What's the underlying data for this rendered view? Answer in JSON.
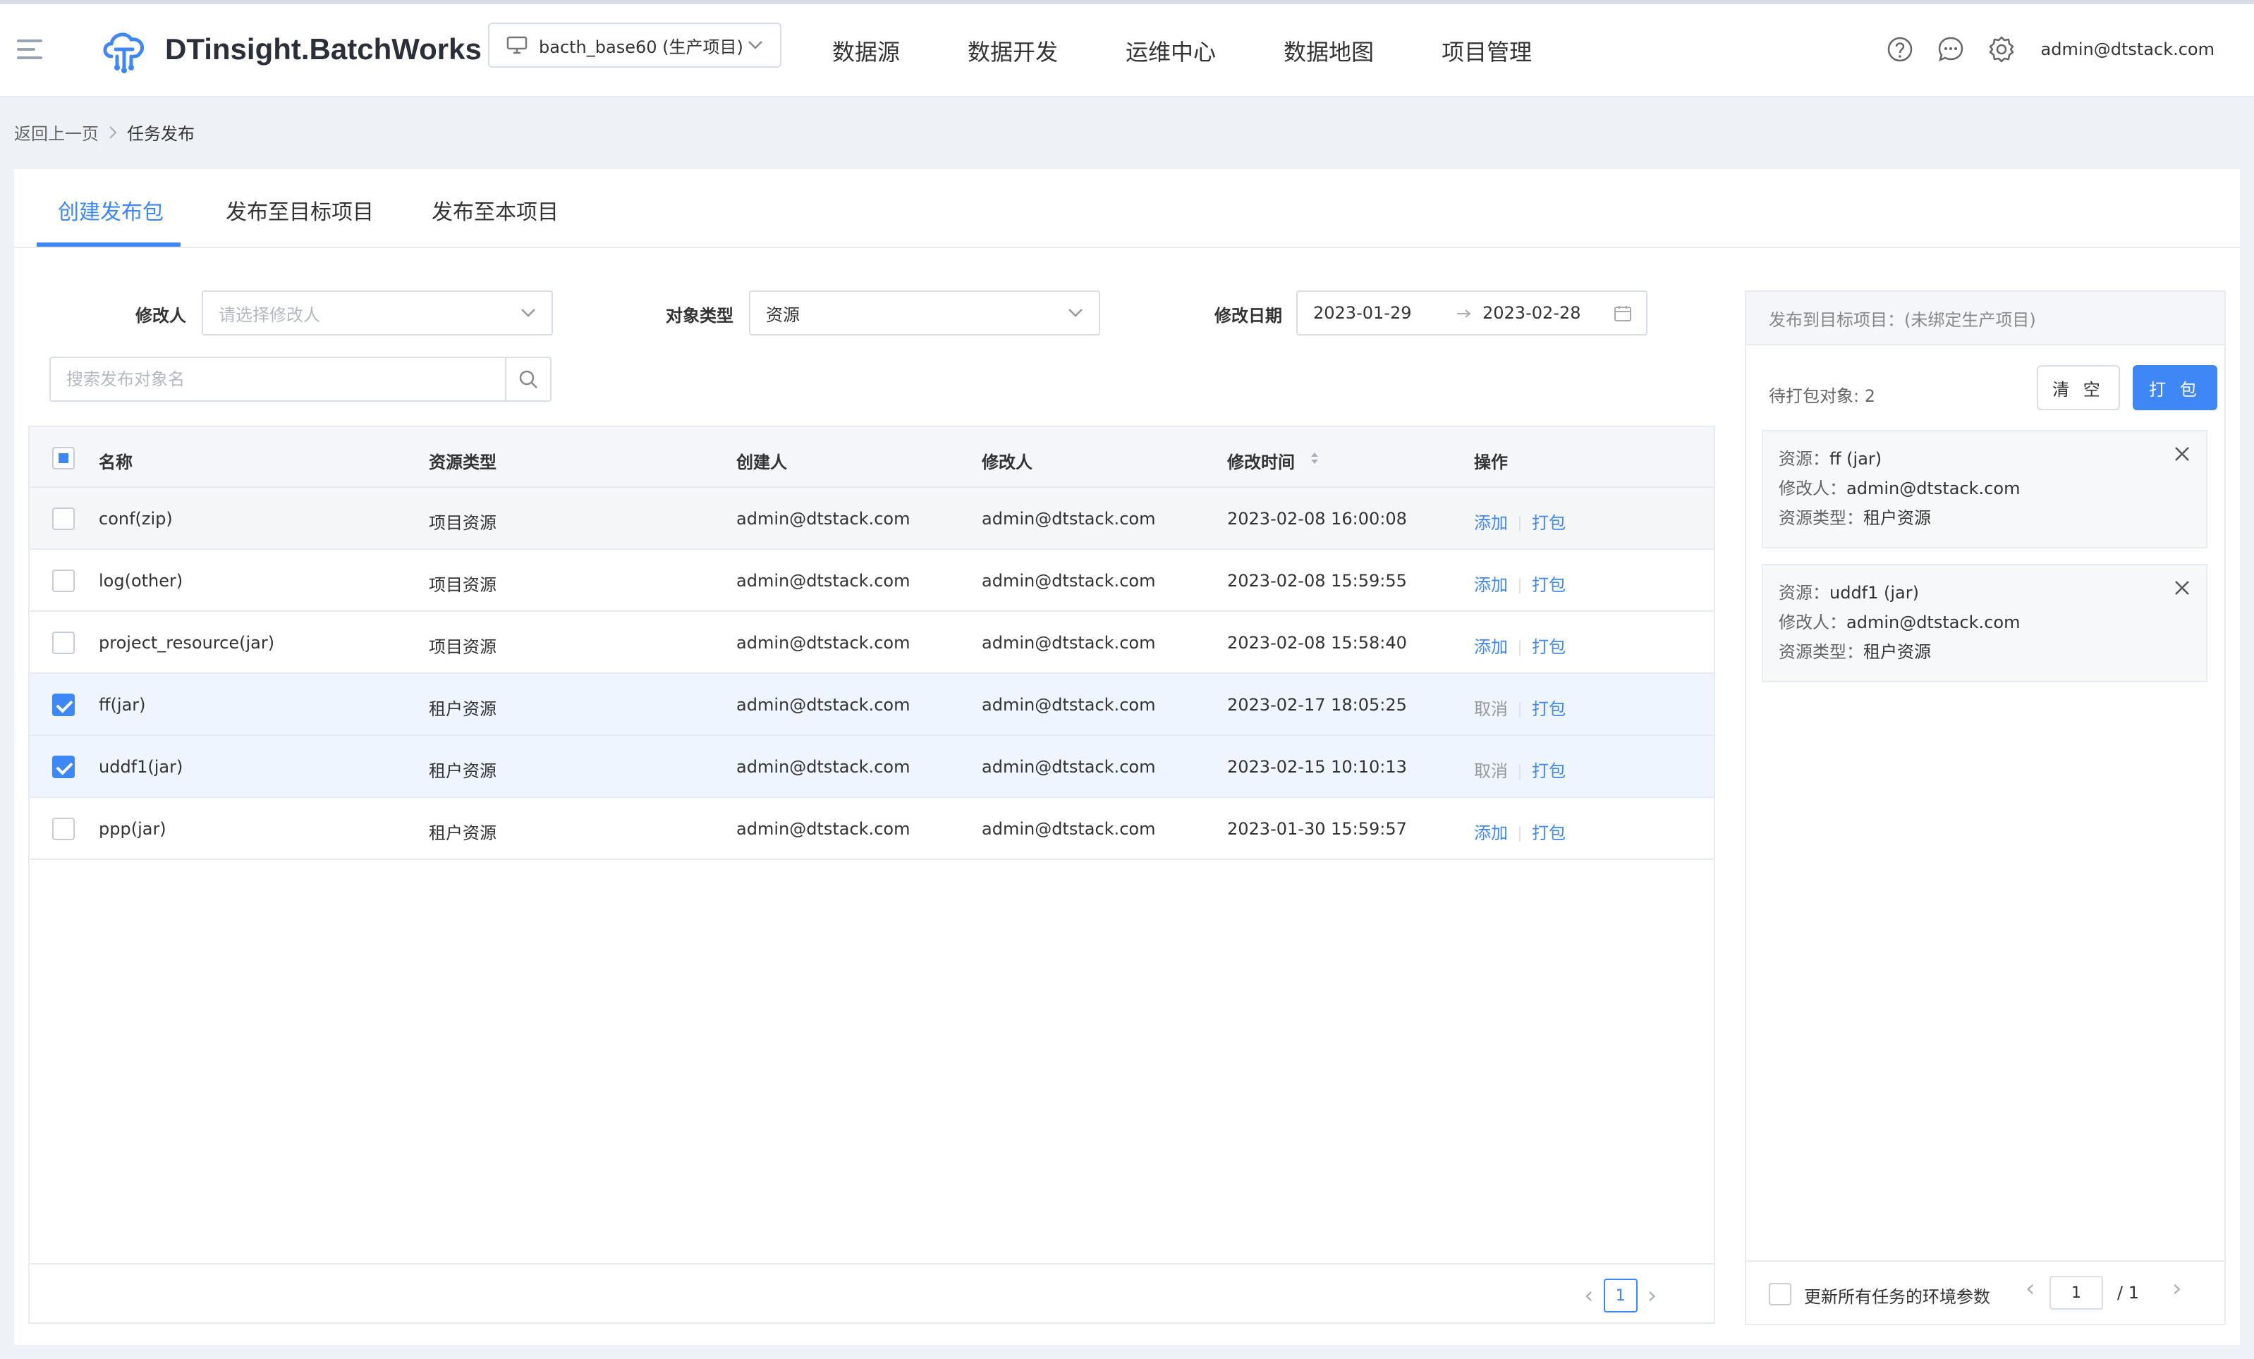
{
  "header": {
    "app_title": "DTinsight.BatchWorks",
    "project": "bacth_base60 (生产项目)",
    "nav": [
      "数据源",
      "数据开发",
      "运维中心",
      "数据地图",
      "项目管理"
    ],
    "user": "admin@dtstack.com"
  },
  "breadcrumb": {
    "back": "返回上一页",
    "current": "任务发布"
  },
  "tabs": [
    "创建发布包",
    "发布至目标项目",
    "发布至本项目"
  ],
  "filters": {
    "modifier_label": "修改人",
    "modifier_placeholder": "请选择修改人",
    "type_label": "对象类型",
    "type_value": "资源",
    "date_label": "修改日期",
    "date_start": "2023-01-29",
    "date_end": "2023-02-28",
    "search_placeholder": "搜索发布对象名"
  },
  "table": {
    "columns": [
      "名称",
      "资源类型",
      "创建人",
      "修改人",
      "修改时间",
      "操作"
    ],
    "rows": [
      {
        "name": "conf(zip)",
        "type": "项目资源",
        "creator": "admin@dtstack.com",
        "modifier": "admin@dtstack.com",
        "time": "2023-02-08 16:00:08",
        "action": "添加",
        "pack": "打包",
        "checked": false
      },
      {
        "name": "log(other)",
        "type": "项目资源",
        "creator": "admin@dtstack.com",
        "modifier": "admin@dtstack.com",
        "time": "2023-02-08 15:59:55",
        "action": "添加",
        "pack": "打包",
        "checked": false
      },
      {
        "name": "project_resource(jar)",
        "type": "项目资源",
        "creator": "admin@dtstack.com",
        "modifier": "admin@dtstack.com",
        "time": "2023-02-08 15:58:40",
        "action": "添加",
        "pack": "打包",
        "checked": false
      },
      {
        "name": "ff(jar)",
        "type": "租户资源",
        "creator": "admin@dtstack.com",
        "modifier": "admin@dtstack.com",
        "time": "2023-02-17 18:05:25",
        "action": "取消",
        "pack": "打包",
        "checked": true
      },
      {
        "name": "uddf1(jar)",
        "type": "租户资源",
        "creator": "admin@dtstack.com",
        "modifier": "admin@dtstack.com",
        "time": "2023-02-15 10:10:13",
        "action": "取消",
        "pack": "打包",
        "checked": true
      },
      {
        "name": "ppp(jar)",
        "type": "租户资源",
        "creator": "admin@dtstack.com",
        "modifier": "admin@dtstack.com",
        "time": "2023-01-30 15:59:57",
        "action": "添加",
        "pack": "打包",
        "checked": false
      }
    ],
    "page": "1"
  },
  "panel": {
    "title": "发布到目标项目：(未绑定生产项目)",
    "pending": "待打包对象: 2",
    "clear": "清 空",
    "pack": "打 包",
    "items": [
      {
        "resource_label": "资源：",
        "resource": "ff (jar)",
        "modifier_label": "修改人：",
        "modifier": "admin@dtstack.com",
        "type_label": "资源类型：",
        "type": "租户资源"
      },
      {
        "resource_label": "资源：",
        "resource": "uddf1 (jar)",
        "modifier_label": "修改人：",
        "modifier": "admin@dtstack.com",
        "type_label": "资源类型：",
        "type": "租户资源"
      }
    ],
    "footer_checkbox": "更新所有任务的环境参数",
    "page": "1",
    "total": "/  1"
  },
  "colors": {
    "primary": "#3f87f5",
    "selected_row": "#eef5fe"
  }
}
